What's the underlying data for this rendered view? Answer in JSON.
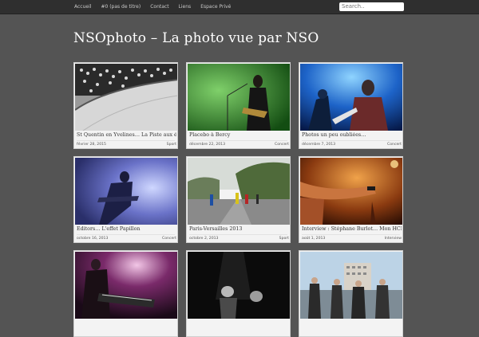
{
  "nav": {
    "items": [
      "Accueil",
      "#0 (pas de titre)",
      "Contact",
      "Liens",
      "Espace Privé"
    ],
    "search_placeholder": "Search.."
  },
  "site": {
    "title": "NSOphoto – La photo vue par NSO"
  },
  "colors": {
    "background": "#545454",
    "topbar": "#2f2f2f",
    "card": "#f3f3f3"
  },
  "posts": [
    {
      "title": "St Quentin en Yvelines… La Piste aux étoiles",
      "date": "février 28, 2015",
      "category": "Sport"
    },
    {
      "title": "Placebo à Bercy",
      "date": "décembre 22, 2013",
      "category": "Concert"
    },
    {
      "title": "Photos un peu oubliées…",
      "date": "décembre 7, 2013",
      "category": "Concert"
    },
    {
      "title": "Editors… L'effet Papillon",
      "date": "octobre 16, 2013",
      "category": "Concert"
    },
    {
      "title": "Paris-Versailles 2013",
      "date": "octobre 2, 2013",
      "category": "Sport"
    },
    {
      "title": "Interview : Stéphane Burlot… Mon HCB",
      "date": "août 1, 2013",
      "category": "Interview"
    },
    {
      "title": "",
      "date": "",
      "category": ""
    },
    {
      "title": "",
      "date": "",
      "category": ""
    },
    {
      "title": "",
      "date": "",
      "category": ""
    }
  ]
}
